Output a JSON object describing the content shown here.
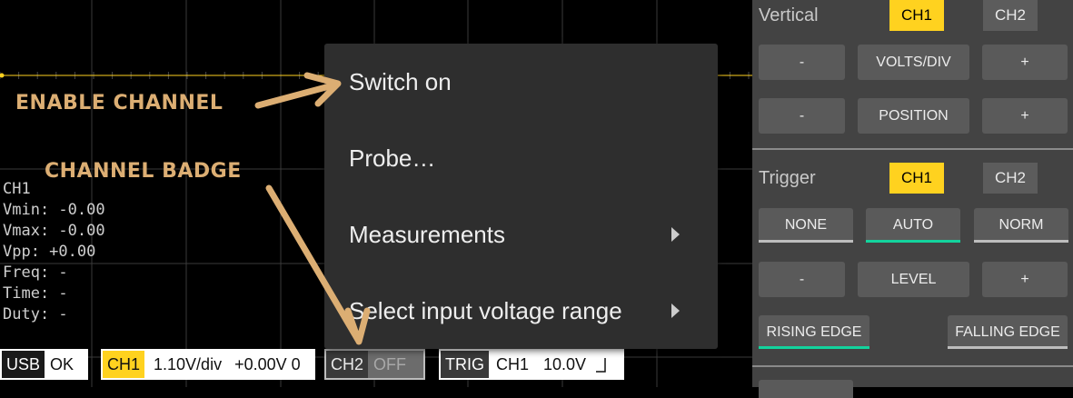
{
  "readout": {
    "channel": "CH1",
    "lines": [
      "Vmin: -0.00",
      "Vmax: -0.00",
      "Vpp: +0.00",
      "Freq: -",
      "Time: -",
      "Duty: -"
    ]
  },
  "annotations": {
    "enable_channel": "ENABLE CHANNEL",
    "channel_badge": "CHANNEL BADGE",
    "color": "#dcae73"
  },
  "context_menu": {
    "items": [
      {
        "label": "Switch on",
        "submenu": false
      },
      {
        "label": "Probe…",
        "submenu": false
      },
      {
        "label": "Measurements",
        "submenu": true
      },
      {
        "label": "Select input voltage range",
        "submenu": true
      }
    ]
  },
  "status_bar": {
    "usb": {
      "tag": "USB",
      "value": "OK"
    },
    "ch1": {
      "tag": "CH1",
      "scale": "1.10V/div",
      "offset": "+0.00V 0"
    },
    "ch2": {
      "tag": "CH2",
      "value": "OFF"
    },
    "trig": {
      "tag": "TRIG",
      "channel": "CH1",
      "level": "10.0V",
      "edge_icon": "rising-edge-icon"
    }
  },
  "panel": {
    "vertical": {
      "title": "Vertical",
      "ch1": "CH1",
      "ch2": "CH2",
      "selected": "CH1",
      "rows": [
        {
          "minus": "-",
          "label": "VOLTS/DIV",
          "plus": "+"
        },
        {
          "minus": "-",
          "label": "POSITION",
          "plus": "+"
        }
      ]
    },
    "trigger": {
      "title": "Trigger",
      "ch1": "CH1",
      "ch2": "CH2",
      "selected": "CH1",
      "modes": [
        "NONE",
        "AUTO",
        "NORM"
      ],
      "active_mode": "AUTO",
      "level_row": {
        "minus": "-",
        "label": "LEVEL",
        "plus": "+"
      },
      "edges": [
        "RISING EDGE",
        "FALLING EDGE"
      ],
      "active_edge": "RISING EDGE"
    }
  },
  "colors": {
    "accent_yellow": "#ffd21f",
    "active_underline": "#13d39d",
    "trace": "#ffd21f"
  }
}
